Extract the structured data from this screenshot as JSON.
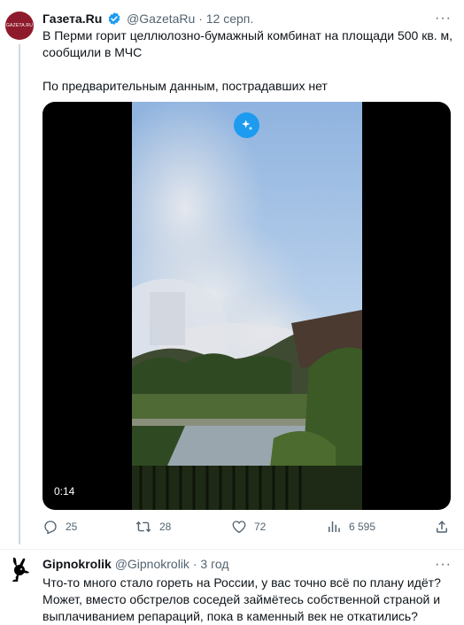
{
  "tweet1": {
    "avatar_text": "GAZETA.RU",
    "name": "Газета.Ru",
    "handle": "@GazetaRu",
    "separator": "·",
    "time": "12 серп.",
    "more_label": "···",
    "text_line1": "В Перми горит целлюлозно-бумажный комбинат на площади 500 кв. м,",
    "text_line2": "сообщили в МЧС",
    "text_line3": "По предварительным данным, пострадавших нет",
    "video_duration": "0:14",
    "stats": {
      "replies": "25",
      "retweets": "28",
      "likes": "72",
      "views": "6 595"
    }
  },
  "tweet2": {
    "name": "Gipnokrolik",
    "handle": "@Gipnokrolik",
    "separator": "·",
    "time": "3 год",
    "more_label": "···",
    "text": "Что-то много стало гореть на России, у вас точно всё по плану идёт? Может, вместо обстрелов соседей займётесь собственной страной и выплачиванием репараций, пока в каменный век не откатились?"
  },
  "colors": {
    "text_primary": "#0f1419",
    "text_secondary": "#536471",
    "verified_blue": "#1d9bf0",
    "avatar_red": "#8e1b2b"
  },
  "icons": [
    "verified-badge-icon",
    "more-icon",
    "reply-icon",
    "retweet-icon",
    "like-icon",
    "views-icon",
    "share-icon",
    "sparkle-icon",
    "playboy-bunny-icon"
  ]
}
